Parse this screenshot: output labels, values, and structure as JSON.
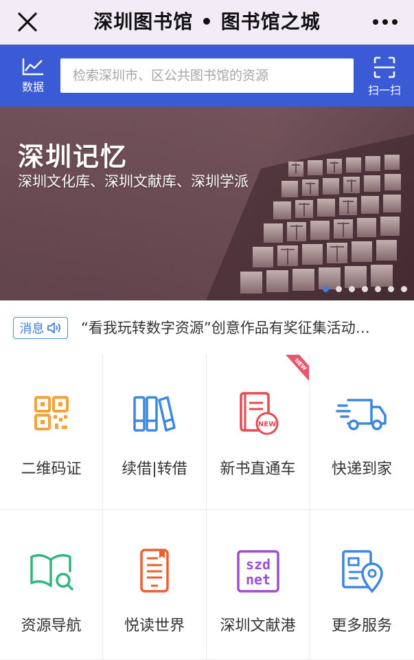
{
  "window": {
    "title": "深圳图书馆 • 图书馆之城",
    "close_icon": "close-icon",
    "more_icon": "more-icon"
  },
  "search": {
    "data_label": "数据",
    "placeholder": "检索深圳市、区公共图书馆的资源",
    "scan_label": "扫一扫"
  },
  "banner": {
    "title": "深圳记忆",
    "subtitle": "深圳文化库、深圳文献库、深圳学派",
    "slide_count": 7,
    "active_slide": 1
  },
  "notice": {
    "tag": "消息",
    "text": "“看我玩转数字资源”创意作品有奖征集活动…"
  },
  "services": [
    {
      "label": "二维码证",
      "icon": "qrcode-icon",
      "color": "#f2a33a"
    },
    {
      "label": "续借|转借",
      "icon": "books-icon",
      "color": "#3a86e0"
    },
    {
      "label": "新书直通车",
      "icon": "new-book-icon",
      "color": "#e5484f",
      "badge": "NEW"
    },
    {
      "label": "快递到家",
      "icon": "delivery-truck-icon",
      "color": "#3a86e0"
    },
    {
      "label": "资源导航",
      "icon": "open-book-search-icon",
      "color": "#2fb67a"
    },
    {
      "label": "悦读世界",
      "icon": "phone-reading-icon",
      "color": "#ec5f2a"
    },
    {
      "label": "深圳文献港",
      "icon": "szdl-logo-icon",
      "color": "#9a4fd0"
    },
    {
      "label": "更多服务",
      "icon": "location-card-icon",
      "color": "#3a86e0"
    }
  ],
  "colors": {
    "accent": "#3b5bd6",
    "titlebar_bg": "#f2ecf6"
  }
}
